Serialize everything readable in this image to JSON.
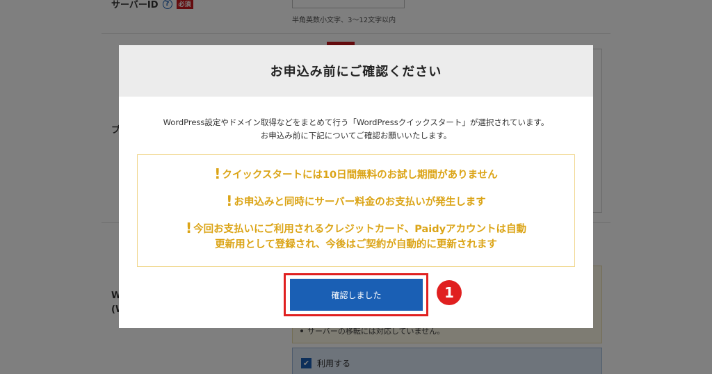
{
  "background": {
    "server_id_label": "サーバーID",
    "help_icon_glyph": "?",
    "required_badge": "必須",
    "server_id_hint": "半角英数小文字、3〜12文字以内",
    "partial_label_p": "プ",
    "partial_label_w1": "W",
    "partial_label_w2": "(W",
    "note_text": "サーバーの移転には対応していません。",
    "use_checkbox_label": "利用する"
  },
  "modal": {
    "title": "お申込み前にご確認ください",
    "intro_line1": "WordPress設定やドメイン取得などをまとめて行う「WordPressクイックスタート」が選択されています。",
    "intro_line2": "お申込み前に下記についてご確認お願いいたします。",
    "warnings": [
      {
        "line": "クイックスタートには10日間無料のお試し期間がありません"
      },
      {
        "line": "お申込みと同時にサーバー料金のお支払いが発生します"
      },
      {
        "line": "今回お支払いにご利用されるクレジットカード、Paidyアカウントは自動",
        "line2": "更新用として登録され、今後はご契約が自動的に更新されます"
      }
    ],
    "exclamation": "!",
    "confirm_button": "確認しました",
    "step_number": "1"
  },
  "colors": {
    "accent_blue": "#1a5fb4",
    "warning_gold": "#dba416",
    "highlight_red": "#e02020"
  }
}
